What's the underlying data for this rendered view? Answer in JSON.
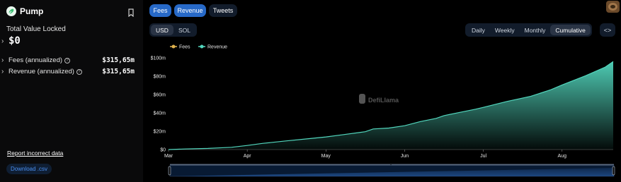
{
  "protocol": {
    "name": "Pump"
  },
  "tvl": {
    "label": "Total Value Locked",
    "value": "$0"
  },
  "metrics": [
    {
      "label": "Fees (annualized)",
      "value": "$315,65m"
    },
    {
      "label": "Revenue (annualized)",
      "value": "$315,65m"
    }
  ],
  "links": {
    "report": "Report incorrect data",
    "download": "Download .csv"
  },
  "toggles": {
    "fees": "Fees",
    "revenue": "Revenue",
    "tweets": "Tweets"
  },
  "currency": {
    "usd": "USD",
    "sol": "SOL"
  },
  "periods": {
    "daily": "Daily",
    "weekly": "Weekly",
    "monthly": "Monthly",
    "cumulative": "Cumulative"
  },
  "embed_label": "<>",
  "watermark": "DefiLlama",
  "colors": {
    "fees": "#e0b24d",
    "revenue": "#52d6bd",
    "accent": "#2769c7"
  },
  "icons": {
    "logo": "pump-pill-icon",
    "bookmark": "bookmark-icon",
    "info": "info-icon",
    "avatar": "user-avatar",
    "embed": "embed-code-icon"
  },
  "chart_data": {
    "type": "area",
    "legend": [
      "Fees",
      "Revenue"
    ],
    "legend_position": "top-left",
    "x_ticks": [
      "Mar",
      "Apr",
      "May",
      "Jun",
      "Jul",
      "Aug"
    ],
    "y_ticks": [
      "$0",
      "$20m",
      "$40m",
      "$60m",
      "$80m",
      "$100m"
    ],
    "ylim": [
      0,
      100
    ],
    "y_unit": "millions USD",
    "grid": false,
    "series": [
      {
        "name": "Revenue",
        "x": [
          0,
          0.1,
          0.2,
          0.5,
          0.8,
          1.0,
          1.2,
          1.5,
          1.8,
          2.0,
          2.2,
          2.5,
          2.6,
          2.8,
          3.0,
          3.2,
          3.4,
          3.5,
          3.7,
          3.9,
          4.0,
          4.3,
          4.6,
          4.85,
          5.0,
          5.3,
          5.55,
          5.65
        ],
        "values": [
          0,
          0.3,
          0.6,
          1.2,
          2.5,
          4.5,
          6.8,
          9.5,
          12,
          13.8,
          16,
          19.5,
          22.5,
          23.5,
          26,
          30.5,
          34,
          37,
          40.5,
          44,
          46,
          52.5,
          58,
          65,
          70.5,
          80.5,
          90,
          96
        ]
      }
    ]
  }
}
